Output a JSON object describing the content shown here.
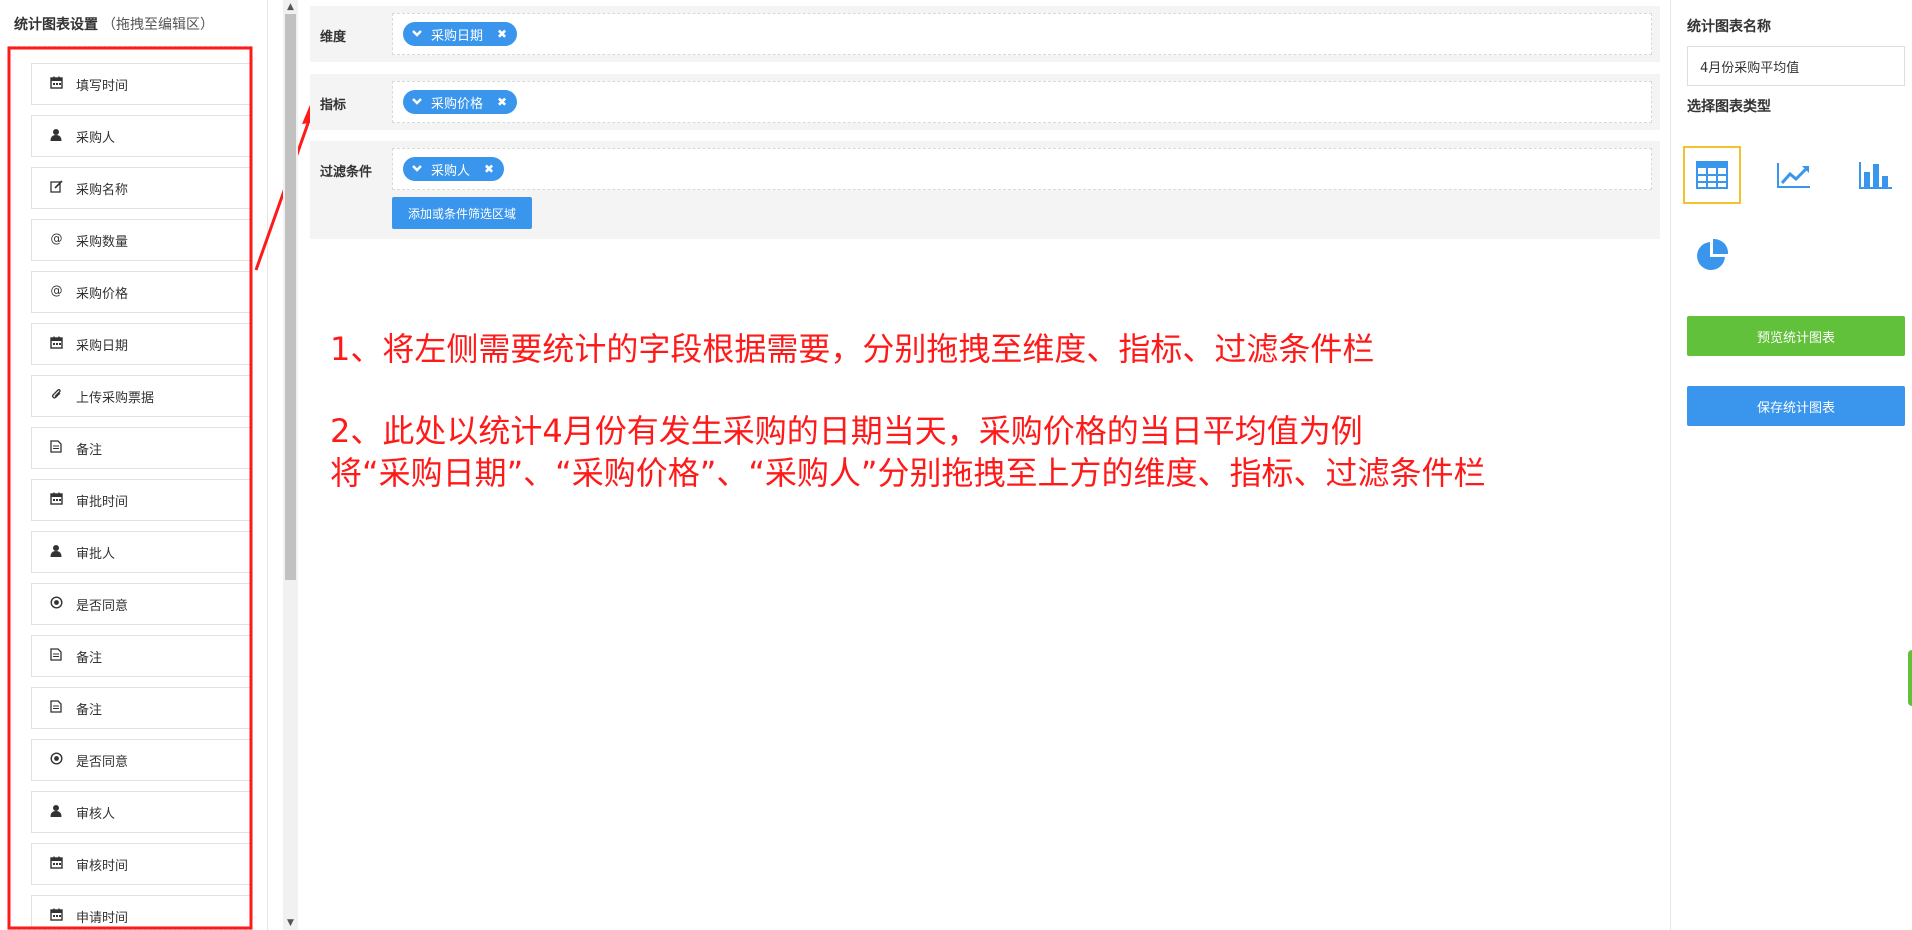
{
  "left_panel": {
    "title": "统计图表设置",
    "hint": "（拖拽至编辑区）",
    "fields": [
      {
        "label": "填写时间",
        "icon": "calendar-icon"
      },
      {
        "label": "采购人",
        "icon": "user-icon"
      },
      {
        "label": "采购名称",
        "icon": "edit-icon"
      },
      {
        "label": "采购数量",
        "icon": "at-icon"
      },
      {
        "label": "采购价格",
        "icon": "at-icon"
      },
      {
        "label": "采购日期",
        "icon": "calendar-icon"
      },
      {
        "label": "上传采购票据",
        "icon": "paperclip-icon"
      },
      {
        "label": "备注",
        "icon": "document-icon"
      },
      {
        "label": "审批时间",
        "icon": "calendar-icon"
      },
      {
        "label": "审批人",
        "icon": "user-icon"
      },
      {
        "label": "是否同意",
        "icon": "radio-icon"
      },
      {
        "label": "备注",
        "icon": "document-icon"
      },
      {
        "label": "备注",
        "icon": "document-icon"
      },
      {
        "label": "是否同意",
        "icon": "radio-icon"
      },
      {
        "label": "审核人",
        "icon": "user-icon"
      },
      {
        "label": "审核时间",
        "icon": "calendar-icon"
      },
      {
        "label": "申请时间",
        "icon": "calendar-icon"
      }
    ]
  },
  "config": {
    "dimension": {
      "label": "维度",
      "tag": "采购日期"
    },
    "metric": {
      "label": "指标",
      "tag": "采购价格"
    },
    "filter": {
      "label": "过滤条件",
      "tag": "采购人",
      "add_button": "添加或条件筛选区域"
    }
  },
  "annotations": {
    "line1": "1、将左侧需要统计的字段根据需要，分别拖拽至维度、指标、过滤条件栏",
    "line2": "2、此处以统计4月份有发生采购的日期当天，采购价格的当日平均值为例",
    "line3": "将“采购日期”、“采购价格”、“采购人”分别拖拽至上方的维度、指标、过滤条件栏"
  },
  "right_panel": {
    "name_label": "统计图表名称",
    "name_value": "4月份采购平均值",
    "type_label": "选择图表类型",
    "chart_types": [
      "table-icon",
      "line-chart-icon",
      "bar-chart-icon",
      "pie-chart-icon"
    ],
    "selected_type": "table-icon",
    "preview_button": "预览统计图表",
    "save_button": "保存统计图表"
  },
  "colors": {
    "tag_blue": "#3a95ec",
    "preview_green": "#61c13a",
    "save_blue": "#3a95ec",
    "annotation_red": "#ff1a1a",
    "selected_border": "#f2c12e"
  }
}
